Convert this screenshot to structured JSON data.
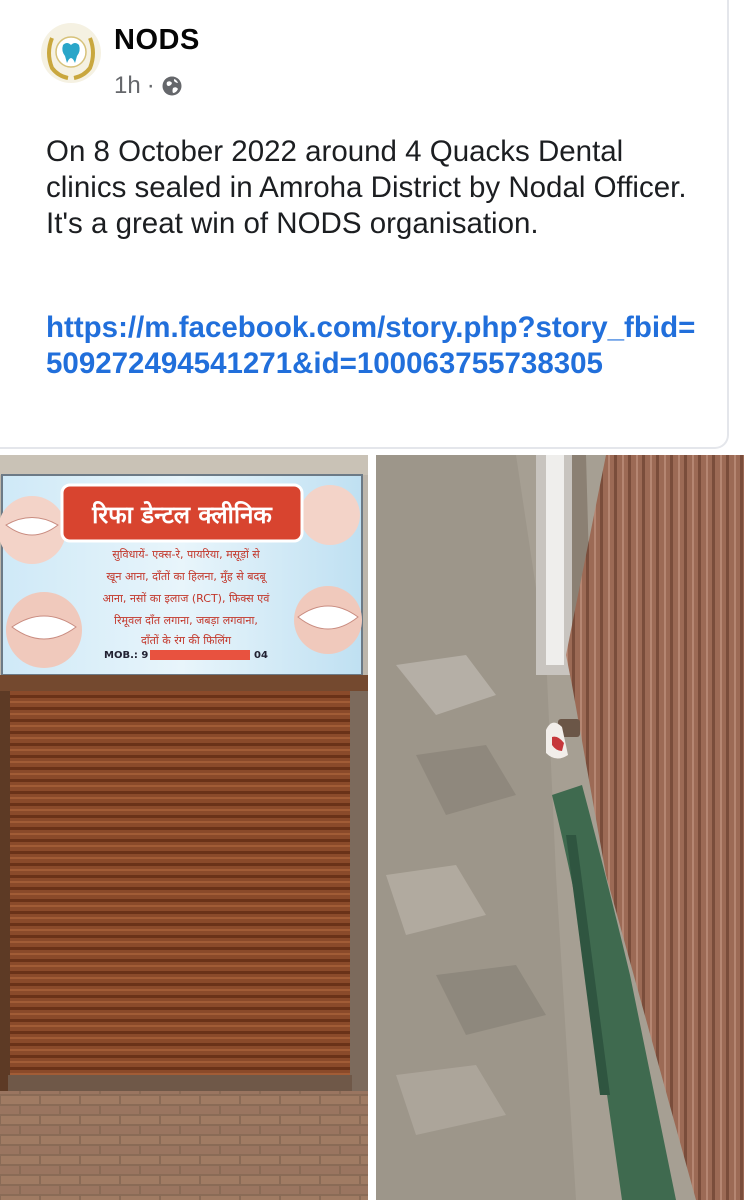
{
  "post": {
    "author": "NODS",
    "time": "1h",
    "separator": "·",
    "privacy_icon": "globe-icon",
    "text": "On 8 October 2022 around 4 Quacks Dental clinics sealed in Amroha District by Nodal Officer. It's a great win of NODS organisation.",
    "link": "https://m.facebook.com/story.php?story_fbid=509272494541271&id=100063755738305"
  },
  "photos": {
    "left": {
      "sign_title": "रिफा डेन्टल क्लीनिक",
      "sign_lines": [
        "सुविधायें- एक्स-रे, पायरिया, मसूड़ों से",
        "खून आना, दाँतों का हिलना, मुँह से बदबू",
        "आना, नसों का इलाज (RCT), फिक्स एवं",
        "रिमूवल दाँत लगाना, जबड़ा लगवाना,",
        "दाँतों के रंग की फिलिंग"
      ],
      "sign_mob": "MOB.: 9",
      "sign_mob_end": "04"
    }
  },
  "colors": {
    "link": "#216fdb",
    "text": "#1c1e21",
    "meta": "#65676b"
  }
}
